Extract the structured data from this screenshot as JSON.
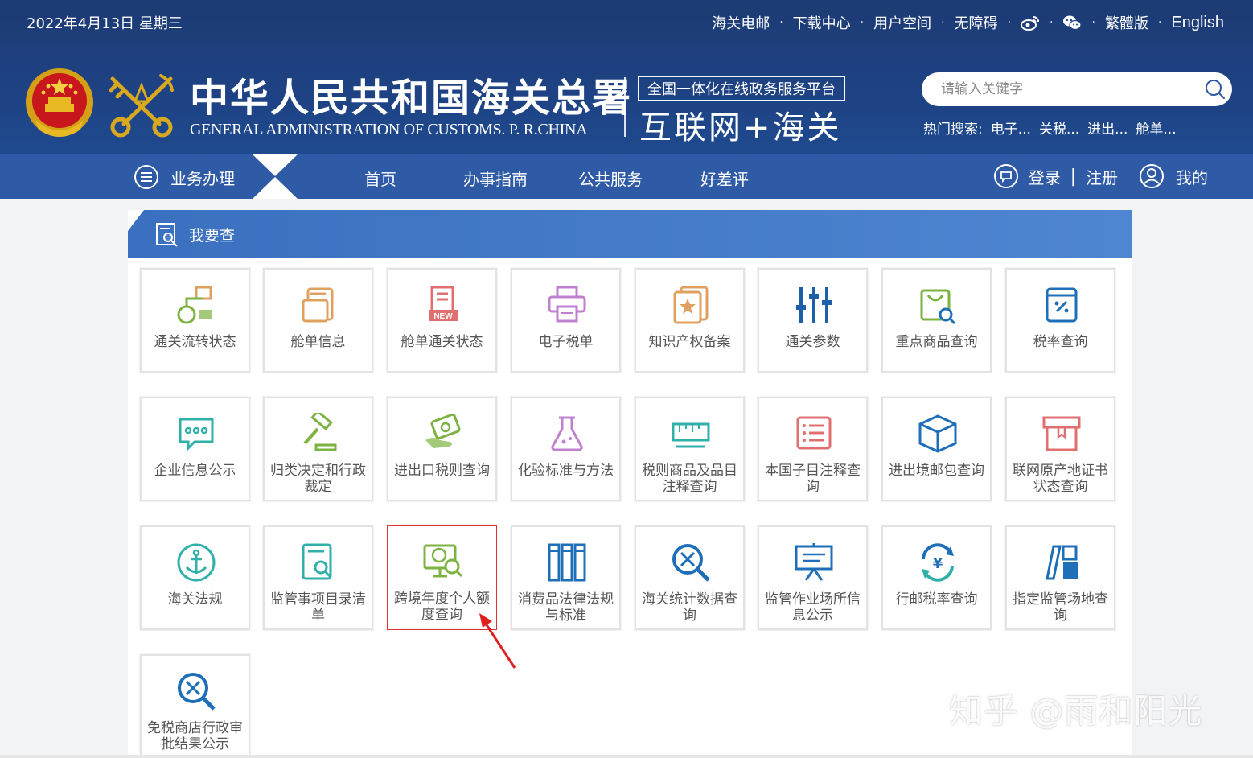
{
  "header": {
    "date": "2022年4月13日  星期三",
    "links": [
      "海关电邮",
      "下载中心",
      "用户空间",
      "无障碍"
    ],
    "lang_links": [
      "繁體版",
      "English"
    ],
    "icon_weibo": "weibo-icon",
    "icon_wechat": "wechat-icon",
    "title_cn": "中华人民共和国海关总署",
    "title_en": "GENERAL ADMINISTRATION OF CUSTOMS. P. R.CHINA",
    "platform_small": "全国一体化在线政务服务平台",
    "platform_big": "互联网+海关"
  },
  "search": {
    "placeholder": "请输入关键字",
    "hot_label": "热门搜索:",
    "hot": [
      "电子...",
      "关税...",
      "进出...",
      "舱单..."
    ]
  },
  "nav": {
    "business": "业务办理",
    "items": [
      "首页",
      "办事指南",
      "公共服务",
      "好差评"
    ],
    "login": "登录",
    "divider": "|",
    "register": "注册",
    "mine": "我的"
  },
  "panel": {
    "title": "我要查",
    "tiles": [
      {
        "label": "通关流转状态",
        "icon": "flow-status-icon"
      },
      {
        "label": "舱单信息",
        "icon": "manifest-icon"
      },
      {
        "label": "舱单通关状态",
        "icon": "news-manifest-icon"
      },
      {
        "label": "电子税单",
        "icon": "printer-icon"
      },
      {
        "label": "知识产权备案",
        "icon": "ip-certificate-icon"
      },
      {
        "label": "通关参数",
        "icon": "sliders-icon"
      },
      {
        "label": "重点商品查询",
        "icon": "shopping-bag-search-icon"
      },
      {
        "label": "税率查询",
        "icon": "tax-rate-book-icon"
      },
      {
        "label": "企业信息公示",
        "icon": "chat-bubble-icon"
      },
      {
        "label": "归类决定和行政裁定",
        "icon": "gavel-icon"
      },
      {
        "label": "进出口税则查询",
        "icon": "money-hand-icon"
      },
      {
        "label": "化验标准与方法",
        "icon": "flask-icon"
      },
      {
        "label": "税则商品及品目注释查询",
        "icon": "ruler-icon"
      },
      {
        "label": "本国子目注释查询",
        "icon": "list-card-icon"
      },
      {
        "label": "进出境邮包查询",
        "icon": "parcel-box-icon"
      },
      {
        "label": "联网原产地证书状态查询",
        "icon": "archive-box-icon"
      },
      {
        "label": "海关法规",
        "icon": "anchor-icon"
      },
      {
        "label": "监管事项目录清单",
        "icon": "document-search-icon"
      },
      {
        "label": "跨境年度个人额度查询",
        "icon": "computer-globe-icon"
      },
      {
        "label": "消费品法律法规与标准",
        "icon": "books-icon"
      },
      {
        "label": "海关统计数据查询",
        "icon": "magnifier-tools-icon"
      },
      {
        "label": "监管作业场所信息公示",
        "icon": "easel-board-icon"
      },
      {
        "label": "行邮税率查询",
        "icon": "yen-refresh-icon"
      },
      {
        "label": "指定监管场地查询",
        "icon": "site-blocks-icon"
      },
      {
        "label": "免税商店行政审批结果公示",
        "icon": "magnifier-tools-icon"
      }
    ]
  },
  "watermark": "知乎 @雨和阳光",
  "colors": {
    "header_dark": "#1d3b74",
    "nav": "#2e5aa6",
    "panel_head": "#4a80cc",
    "highlight": "#e03030"
  }
}
